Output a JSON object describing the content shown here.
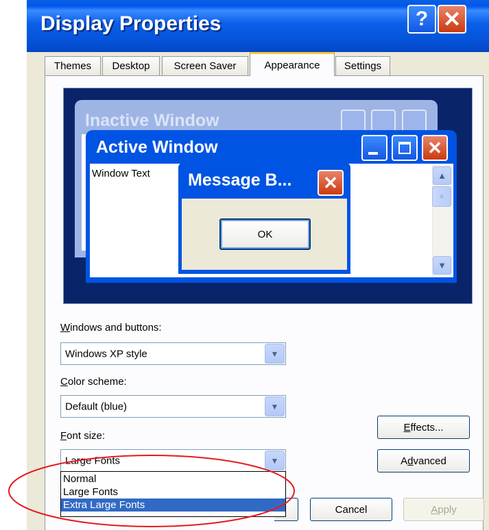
{
  "window": {
    "title": "Display Properties",
    "help_label": "?",
    "close_label": "✕"
  },
  "tabs": [
    {
      "label": "Themes",
      "active": false
    },
    {
      "label": "Desktop",
      "active": false
    },
    {
      "label": "Screen Saver",
      "active": false
    },
    {
      "label": "Appearance",
      "active": true
    },
    {
      "label": "Settings",
      "active": false
    }
  ],
  "preview": {
    "inactive_title": "Inactive Window",
    "active_title": "Active Window",
    "window_text": "Window Text",
    "message_title": "Message B...",
    "ok_label": "OK"
  },
  "windows_and_buttons": {
    "label_underlined": "W",
    "label_rest": "indows and buttons:",
    "value": "Windows XP style"
  },
  "color_scheme": {
    "label_underlined": "C",
    "label_rest": "olor scheme:",
    "value": "Default (blue)"
  },
  "font_size": {
    "label_underlined": "F",
    "label_rest": "ont size:",
    "value": "Large Fonts",
    "options": [
      "Normal",
      "Large Fonts",
      "Extra Large Fonts"
    ],
    "highlighted_index": 2
  },
  "buttons": {
    "effects_underlined": "E",
    "effects_rest": "ffects...",
    "advanced_pre": "A",
    "advanced_underlined": "d",
    "advanced_rest": "vanced",
    "cancel": "Cancel",
    "apply_underlined": "A",
    "apply_rest": "pply"
  },
  "colors": {
    "title_blue": "#0054e3",
    "highlight": "#316ac5",
    "annotation_red": "#e8181f"
  }
}
